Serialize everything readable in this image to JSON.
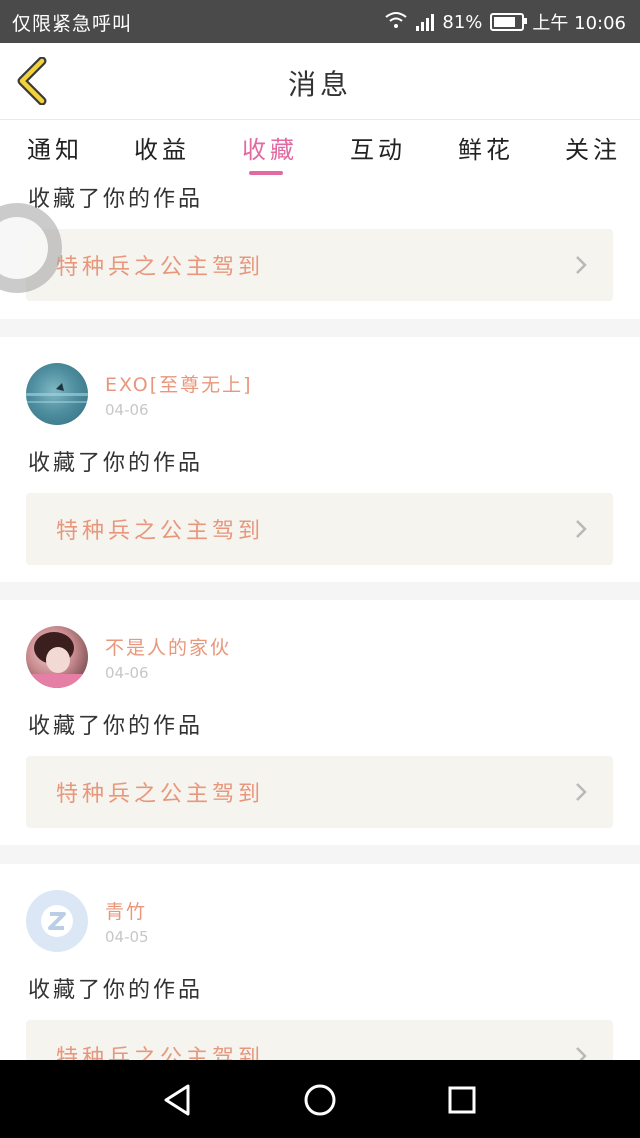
{
  "status_bar": {
    "carrier": "仅限紧急呼叫",
    "battery_percent": "81%",
    "battery_level": 0.81,
    "time": "上午 10:06"
  },
  "header": {
    "title": "消息",
    "back_icon": "chevron-left-icon"
  },
  "tabs": [
    {
      "label": "通知",
      "active": false
    },
    {
      "label": "收益",
      "active": false
    },
    {
      "label": "收藏",
      "active": true
    },
    {
      "label": "互动",
      "active": false
    },
    {
      "label": "鲜花",
      "active": false
    },
    {
      "label": "关注",
      "active": false
    }
  ],
  "colors": {
    "accent": "#e26aa0",
    "username": "#e8977c",
    "card_bg": "#f5f4ef"
  },
  "messages": [
    {
      "message": "收藏了你的作品",
      "work_title": "特种兵之公主驾到"
    },
    {
      "username": "EXO[至尊无上]",
      "date": "04-06",
      "message": "收藏了你的作品",
      "work_title": "特种兵之公主驾到"
    },
    {
      "username": "不是人的家伙",
      "date": "04-06",
      "message": "收藏了你的作品",
      "work_title": "特种兵之公主驾到"
    },
    {
      "username": "青竹",
      "date": "04-05",
      "message": "收藏了你的作品",
      "work_title": "特种兵之公主驾到"
    }
  ]
}
